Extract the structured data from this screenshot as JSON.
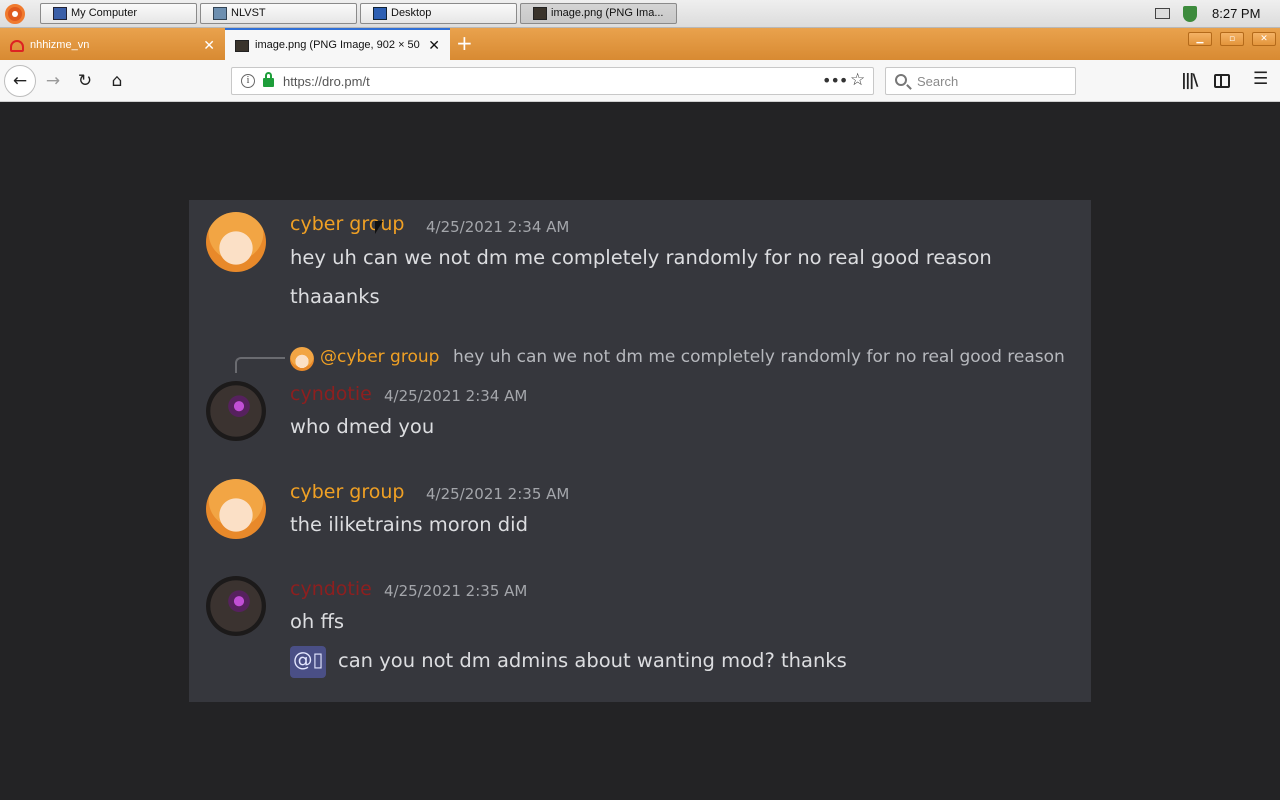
{
  "taskbar": {
    "buttons": [
      {
        "label": "My Computer",
        "icon": "computer-icon"
      },
      {
        "label": "NLVST",
        "icon": "nlvst-icon"
      },
      {
        "label": "Desktop",
        "icon": "desktop-icon"
      },
      {
        "label": "image.png (PNG Ima...",
        "icon": "image-icon"
      }
    ],
    "clock": "8:27 PM"
  },
  "browser": {
    "tabs": [
      {
        "label": "nhhizme_vn",
        "active": false
      },
      {
        "label": "image.png (PNG Image, 902 × 50",
        "active": true
      }
    ],
    "url": "https://dro.pm/t",
    "search_placeholder": "Search",
    "accent": "#d88a32"
  },
  "chat": {
    "messages": [
      {
        "username": "cyber group",
        "username_color": "#f0a024",
        "timestamp": "4/25/2021 2:34 AM",
        "lines": [
          "hey uh can we not dm me completely randomly for no real good reason",
          "thaaanks"
        ]
      },
      {
        "reply": {
          "username": "@cyber group",
          "text": "hey uh can we not dm me completely randomly for no real good reason"
        },
        "username": "cyndotie",
        "username_color": "#8d1f1f",
        "timestamp": "4/25/2021 2:34 AM",
        "lines": [
          "who dmed you"
        ]
      },
      {
        "username": "cyber group",
        "username_color": "#f0a024",
        "timestamp": "4/25/2021 2:35 AM",
        "lines": [
          "the iliketrains moron did"
        ]
      },
      {
        "username": "cyndotie",
        "username_color": "#8d1f1f",
        "timestamp": "4/25/2021 2:35 AM",
        "lines": [
          "oh ffs"
        ],
        "mention": "@▯",
        "mention_text": "can you not dm admins about wanting mod? thanks"
      }
    ]
  }
}
